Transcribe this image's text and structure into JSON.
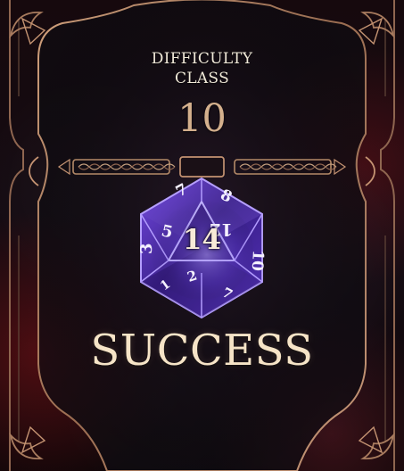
{
  "header": {
    "label_line_1": "DIFFICULTY",
    "label_line_2": "CLASS"
  },
  "difficulty_class": {
    "value": "10"
  },
  "roll": {
    "value": "14"
  },
  "outcome": {
    "label": "SUCCESS"
  },
  "icons": {
    "die": "d20-icon",
    "frame": "ornate-frame-icon",
    "divider": "ornamental-divider-icon"
  },
  "colors": {
    "gold": "#b48a68",
    "cream": "#f1ead9",
    "bronze": "#d4b08d",
    "die_purple": "#5a33c8",
    "die_glow": "#a68cff"
  }
}
